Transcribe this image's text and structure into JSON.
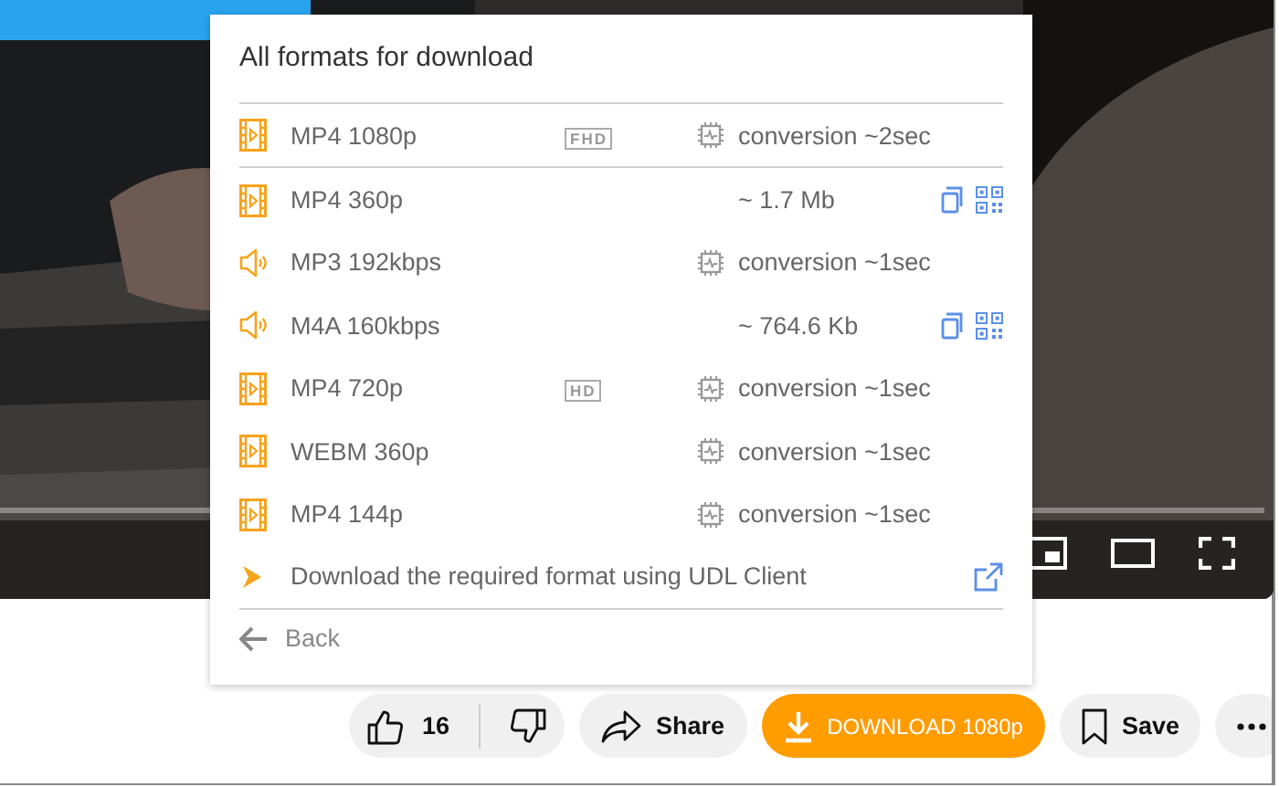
{
  "popup": {
    "title": "All formats for download",
    "formats": [
      {
        "kind": "video",
        "name": "MP4 1080p",
        "badge": "FHD",
        "info": "conversion ~2sec",
        "converting": true,
        "copy_qr": false,
        "divider_after": true
      },
      {
        "kind": "video",
        "name": "MP4 360p",
        "info": "~ 1.7 Mb",
        "converting": false,
        "copy_qr": true,
        "divider_after": false
      },
      {
        "kind": "audio",
        "name": "MP3 192kbps",
        "info": "conversion ~1sec",
        "converting": true,
        "copy_qr": false,
        "divider_after": false
      },
      {
        "kind": "audio",
        "name": "M4A 160kbps",
        "info": "~ 764.6 Kb",
        "converting": false,
        "copy_qr": true,
        "divider_after": false
      },
      {
        "kind": "video",
        "name": "MP4 720p",
        "badge": "HD",
        "info": "conversion ~1sec",
        "converting": true,
        "copy_qr": false,
        "divider_after": false
      },
      {
        "kind": "video",
        "name": "WEBM 360p",
        "info": "conversion ~1sec",
        "converting": true,
        "copy_qr": false,
        "divider_after": false
      },
      {
        "kind": "video",
        "name": "MP4 144p",
        "info": "conversion ~1sec",
        "converting": true,
        "copy_qr": false,
        "divider_after": false
      }
    ],
    "client_link": "Download the required format using UDL Client",
    "back": "Back"
  },
  "actions": {
    "likes": "16",
    "share": "Share",
    "download": "DOWNLOAD 1080p",
    "save": "Save"
  }
}
